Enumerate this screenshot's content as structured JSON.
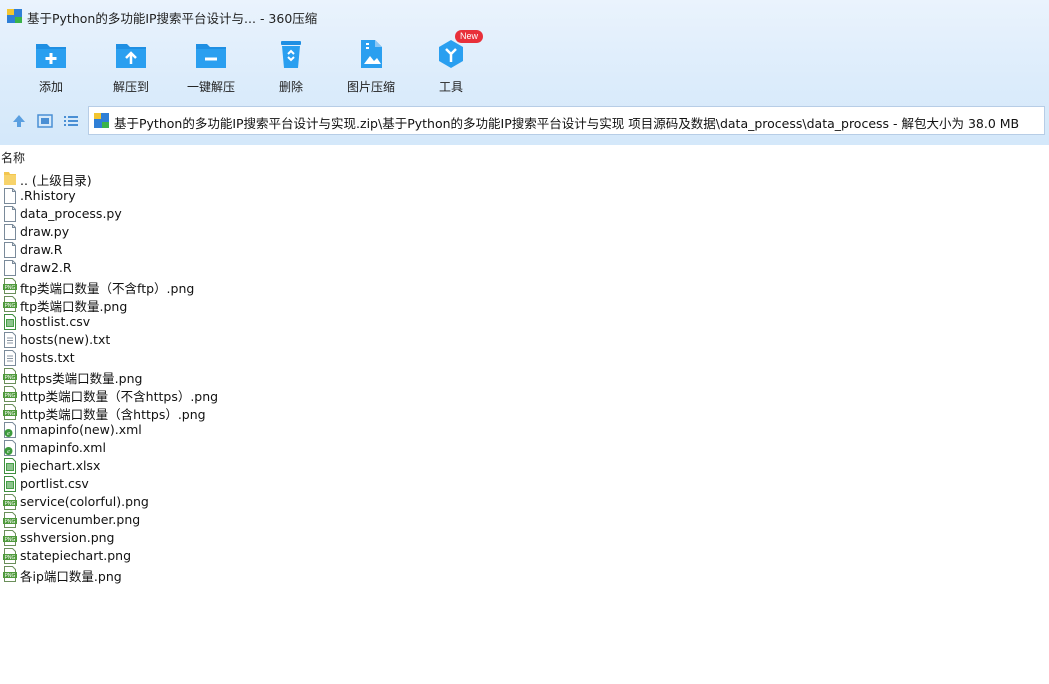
{
  "window": {
    "title": "基于Python的多功能IP搜索平台设计与... - 360压缩",
    "app_icon": "archive-icon"
  },
  "toolbar": {
    "items": [
      {
        "label": "添加",
        "icon": "add-folder-icon"
      },
      {
        "label": "解压到",
        "icon": "extract-to-icon"
      },
      {
        "label": "一键解压",
        "icon": "one-click-extract-icon"
      },
      {
        "label": "删除",
        "icon": "recycle-bin-icon"
      },
      {
        "label": "图片压缩",
        "icon": "image-compress-icon"
      },
      {
        "label": "工具",
        "icon": "tools-icon",
        "badge": "New"
      }
    ]
  },
  "nav": {
    "path": "基于Python的多功能IP搜索平台设计与实现.zip\\基于Python的多功能IP搜索平台设计与实现 项目源码及数据\\data_process\\data_process - 解包大小为 38.0 MB"
  },
  "list": {
    "column_name": "名称",
    "files": [
      {
        "name": ".. (上级目录)",
        "type": "folder"
      },
      {
        "name": ".Rhistory",
        "type": "blank"
      },
      {
        "name": "data_process.py",
        "type": "blank"
      },
      {
        "name": "draw.py",
        "type": "blank"
      },
      {
        "name": "draw.R",
        "type": "blank"
      },
      {
        "name": "draw2.R",
        "type": "blank"
      },
      {
        "name": "ftp类端口数量（不含ftp）.png",
        "type": "png"
      },
      {
        "name": "ftp类端口数量.png",
        "type": "png"
      },
      {
        "name": "hostlist.csv",
        "type": "csv"
      },
      {
        "name": "hosts(new).txt",
        "type": "txt"
      },
      {
        "name": "hosts.txt",
        "type": "txt"
      },
      {
        "name": "https类端口数量.png",
        "type": "png"
      },
      {
        "name": "http类端口数量（不含https）.png",
        "type": "png"
      },
      {
        "name": "http类端口数量（含https）.png",
        "type": "png"
      },
      {
        "name": "nmapinfo(new).xml",
        "type": "xml"
      },
      {
        "name": "nmapinfo.xml",
        "type": "xml"
      },
      {
        "name": "piechart.xlsx",
        "type": "csv"
      },
      {
        "name": "portlist.csv",
        "type": "csv"
      },
      {
        "name": "service(colorful).png",
        "type": "png"
      },
      {
        "name": "servicenumber.png",
        "type": "png"
      },
      {
        "name": "sshversion.png",
        "type": "png"
      },
      {
        "name": "statepiechart.png",
        "type": "png"
      },
      {
        "name": "各ip端口数量.png",
        "type": "png"
      }
    ]
  },
  "colors": {
    "toolbar_bg": "#dcecfb",
    "icon_blue": "#1f8fe3",
    "badge_red": "#e8303a"
  }
}
